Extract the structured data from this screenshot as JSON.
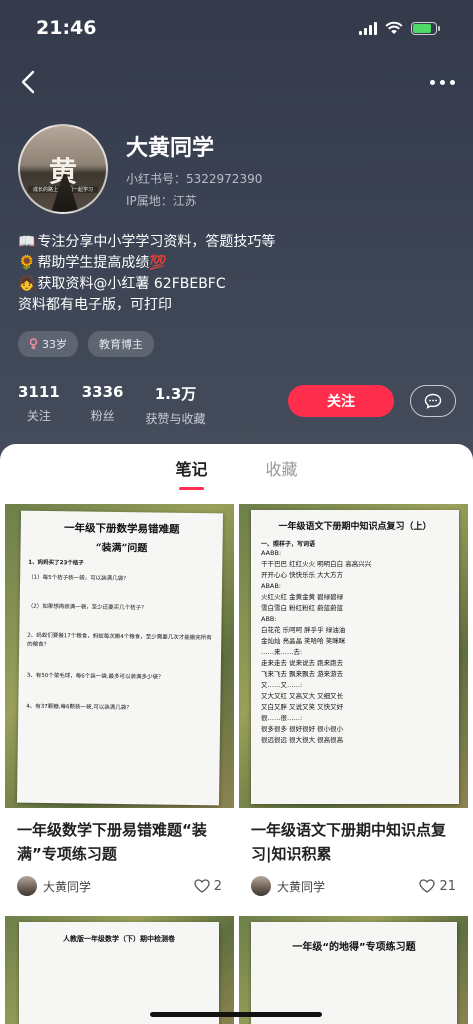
{
  "status_bar": {
    "time": "21:46"
  },
  "profile": {
    "name": "大黄同学",
    "xhs_id": "小红书号：5322972390",
    "ip_location": "IP属地：江苏",
    "avatar_char": "黄",
    "avatar_caption": "成长的路上，我们一起学习",
    "bio": [
      {
        "icon": "📖",
        "text": "专注分享中小学学习资料，答题技巧等"
      },
      {
        "icon": "🌻",
        "text": "帮助学生提高成绩💯"
      },
      {
        "icon": "👧",
        "text": "获取资料@小红薯 62FBEBFC"
      },
      {
        "icon": "",
        "text": "资料都有电子版，可打印"
      }
    ],
    "tags": {
      "age": "33岁",
      "role": "教育博主"
    },
    "stats": [
      {
        "value": "3111",
        "label": "关注"
      },
      {
        "value": "3336",
        "label": "粉丝"
      },
      {
        "value": "1.3万",
        "label": "获赞与收藏"
      }
    ],
    "follow_label": "关注"
  },
  "tabs": [
    {
      "label": "笔记",
      "active": true
    },
    {
      "label": "收藏",
      "active": false
    }
  ],
  "notes": [
    {
      "title": "一年级数学下册易错难题“装满”专项练习题",
      "author": "大黄同学",
      "likes": "2",
      "paper_title": "一年级下册数学易错难题",
      "paper_sub": "“装满”问题",
      "paper_lines": [
        "1、妈妈买了23个桔子",
        "（1）每5个桔子装一袋，可以装满几袋？",
        "（2）如果想再装满一袋，至少还要买几个桔子？",
        "2、蚂蚁们要搬17个粮食，蚂蚁每次搬4个粮食，至少需要几次才能搬完所有的粮食？",
        "3、有50个菜毛球，每6个装一袋,最多可以装满多少袋？",
        "4、有37颗糖,每6颗装一袋,可以装满几袋？"
      ]
    },
    {
      "title": "一年级语文下册期中知识点复习|知识积累",
      "author": "大黄同学",
      "likes": "21",
      "paper_title": "一年级语文下册期中知识点复习（上）",
      "paper_section": "一、照样子，写词语",
      "paper_rows": [
        "AABB:",
        "干干巴巴  红红火火  明明白白  高高兴兴",
        "开开心心  快快乐乐  大大方方",
        "ABAB:",
        "火红火红  金黄金黄  碧绿碧绿",
        "雪白雪白  粉红粉红  蔚蓝蔚蓝",
        "ABB:",
        "白花花  乐呵呵  胖乎乎  绿油油",
        "金灿灿  亮晶晶  笑哈哈  笑眯眯",
        "……来……去:",
        "走来走去  说来说去  跑来跑去",
        "飞来飞去  飘来飘去  游来游去",
        "又……又……:",
        "又大又红  又高又大  又细又长",
        "又白又胖  又说又笑  又快又好",
        "很……很……:",
        "很多很多  很好很好  很小很小",
        "很远很远  很大很大  很高很高"
      ]
    },
    {
      "paper_title": "人教版一年级数学（下）期中检测卷"
    },
    {
      "paper_title": "一年级“的地得”专项练习题"
    }
  ]
}
